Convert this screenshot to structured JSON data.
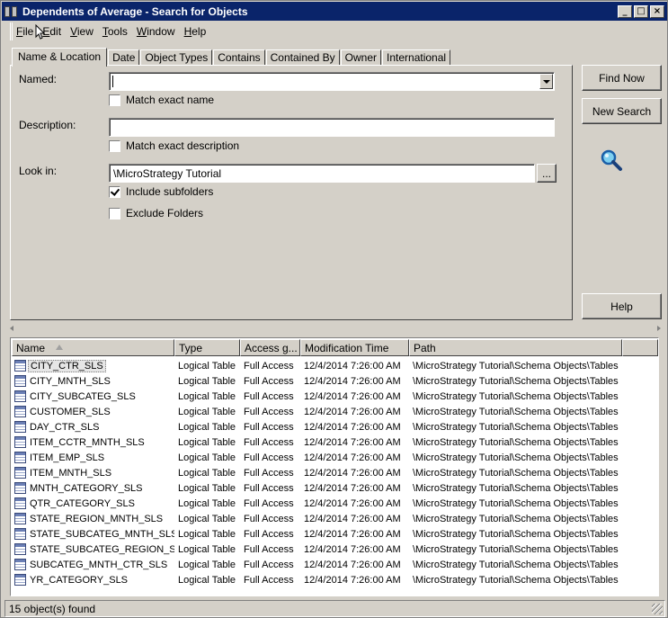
{
  "window": {
    "title": "Dependents of Average - Search for Objects"
  },
  "menu": [
    {
      "label": "File",
      "key": "F"
    },
    {
      "label": "Edit",
      "key": "E"
    },
    {
      "label": "View",
      "key": "V"
    },
    {
      "label": "Tools",
      "key": "T"
    },
    {
      "label": "Window",
      "key": "W"
    },
    {
      "label": "Help",
      "key": "H"
    }
  ],
  "tabs": [
    "Name & Location",
    "Date",
    "Object Types",
    "Contains",
    "Contained By",
    "Owner",
    "International"
  ],
  "form": {
    "named_label": "Named:",
    "named_value": "",
    "match_exact_name": "Match exact name",
    "match_exact_name_checked": false,
    "description_label": "Description:",
    "description_value": "",
    "match_exact_description": "Match exact description",
    "match_exact_description_checked": false,
    "look_in_label": "Look in:",
    "look_in_value": "\\MicroStrategy Tutorial",
    "browse_label": "...",
    "include_subfolders": "Include subfolders",
    "include_subfolders_checked": true,
    "exclude_folders": "Exclude Folders",
    "exclude_folders_checked": false
  },
  "buttons": {
    "find_now": "Find Now",
    "new_search": "New Search",
    "help": "Help"
  },
  "results": {
    "columns": [
      "Name",
      "Type",
      "Access g...",
      "Modification Time",
      "Path"
    ],
    "rows": [
      {
        "name": "CITY_CTR_SLS",
        "type": "Logical Table",
        "access": "Full Access",
        "modified": "12/4/2014 7:26:00 AM",
        "path": "\\MicroStrategy Tutorial\\Schema Objects\\Tables"
      },
      {
        "name": "CITY_MNTH_SLS",
        "type": "Logical Table",
        "access": "Full Access",
        "modified": "12/4/2014 7:26:00 AM",
        "path": "\\MicroStrategy Tutorial\\Schema Objects\\Tables"
      },
      {
        "name": "CITY_SUBCATEG_SLS",
        "type": "Logical Table",
        "access": "Full Access",
        "modified": "12/4/2014 7:26:00 AM",
        "path": "\\MicroStrategy Tutorial\\Schema Objects\\Tables"
      },
      {
        "name": "CUSTOMER_SLS",
        "type": "Logical Table",
        "access": "Full Access",
        "modified": "12/4/2014 7:26:00 AM",
        "path": "\\MicroStrategy Tutorial\\Schema Objects\\Tables"
      },
      {
        "name": "DAY_CTR_SLS",
        "type": "Logical Table",
        "access": "Full Access",
        "modified": "12/4/2014 7:26:00 AM",
        "path": "\\MicroStrategy Tutorial\\Schema Objects\\Tables"
      },
      {
        "name": "ITEM_CCTR_MNTH_SLS",
        "type": "Logical Table",
        "access": "Full Access",
        "modified": "12/4/2014 7:26:00 AM",
        "path": "\\MicroStrategy Tutorial\\Schema Objects\\Tables"
      },
      {
        "name": "ITEM_EMP_SLS",
        "type": "Logical Table",
        "access": "Full Access",
        "modified": "12/4/2014 7:26:00 AM",
        "path": "\\MicroStrategy Tutorial\\Schema Objects\\Tables"
      },
      {
        "name": "ITEM_MNTH_SLS",
        "type": "Logical Table",
        "access": "Full Access",
        "modified": "12/4/2014 7:26:00 AM",
        "path": "\\MicroStrategy Tutorial\\Schema Objects\\Tables"
      },
      {
        "name": "MNTH_CATEGORY_SLS",
        "type": "Logical Table",
        "access": "Full Access",
        "modified": "12/4/2014 7:26:00 AM",
        "path": "\\MicroStrategy Tutorial\\Schema Objects\\Tables"
      },
      {
        "name": "QTR_CATEGORY_SLS",
        "type": "Logical Table",
        "access": "Full Access",
        "modified": "12/4/2014 7:26:00 AM",
        "path": "\\MicroStrategy Tutorial\\Schema Objects\\Tables"
      },
      {
        "name": "STATE_REGION_MNTH_SLS",
        "type": "Logical Table",
        "access": "Full Access",
        "modified": "12/4/2014 7:26:00 AM",
        "path": "\\MicroStrategy Tutorial\\Schema Objects\\Tables"
      },
      {
        "name": "STATE_SUBCATEG_MNTH_SLS",
        "type": "Logical Table",
        "access": "Full Access",
        "modified": "12/4/2014 7:26:00 AM",
        "path": "\\MicroStrategy Tutorial\\Schema Objects\\Tables"
      },
      {
        "name": "STATE_SUBCATEG_REGION_SLS",
        "type": "Logical Table",
        "access": "Full Access",
        "modified": "12/4/2014 7:26:00 AM",
        "path": "\\MicroStrategy Tutorial\\Schema Objects\\Tables"
      },
      {
        "name": "SUBCATEG_MNTH_CTR_SLS",
        "type": "Logical Table",
        "access": "Full Access",
        "modified": "12/4/2014 7:26:00 AM",
        "path": "\\MicroStrategy Tutorial\\Schema Objects\\Tables"
      },
      {
        "name": "YR_CATEGORY_SLS",
        "type": "Logical Table",
        "access": "Full Access",
        "modified": "12/4/2014 7:26:00 AM",
        "path": "\\MicroStrategy Tutorial\\Schema Objects\\Tables"
      }
    ],
    "icon": "logical-table-icon"
  },
  "status": {
    "text": "15 object(s) found"
  },
  "colors": {
    "titlebar": "#0a246a",
    "face": "#d4d0c8"
  }
}
